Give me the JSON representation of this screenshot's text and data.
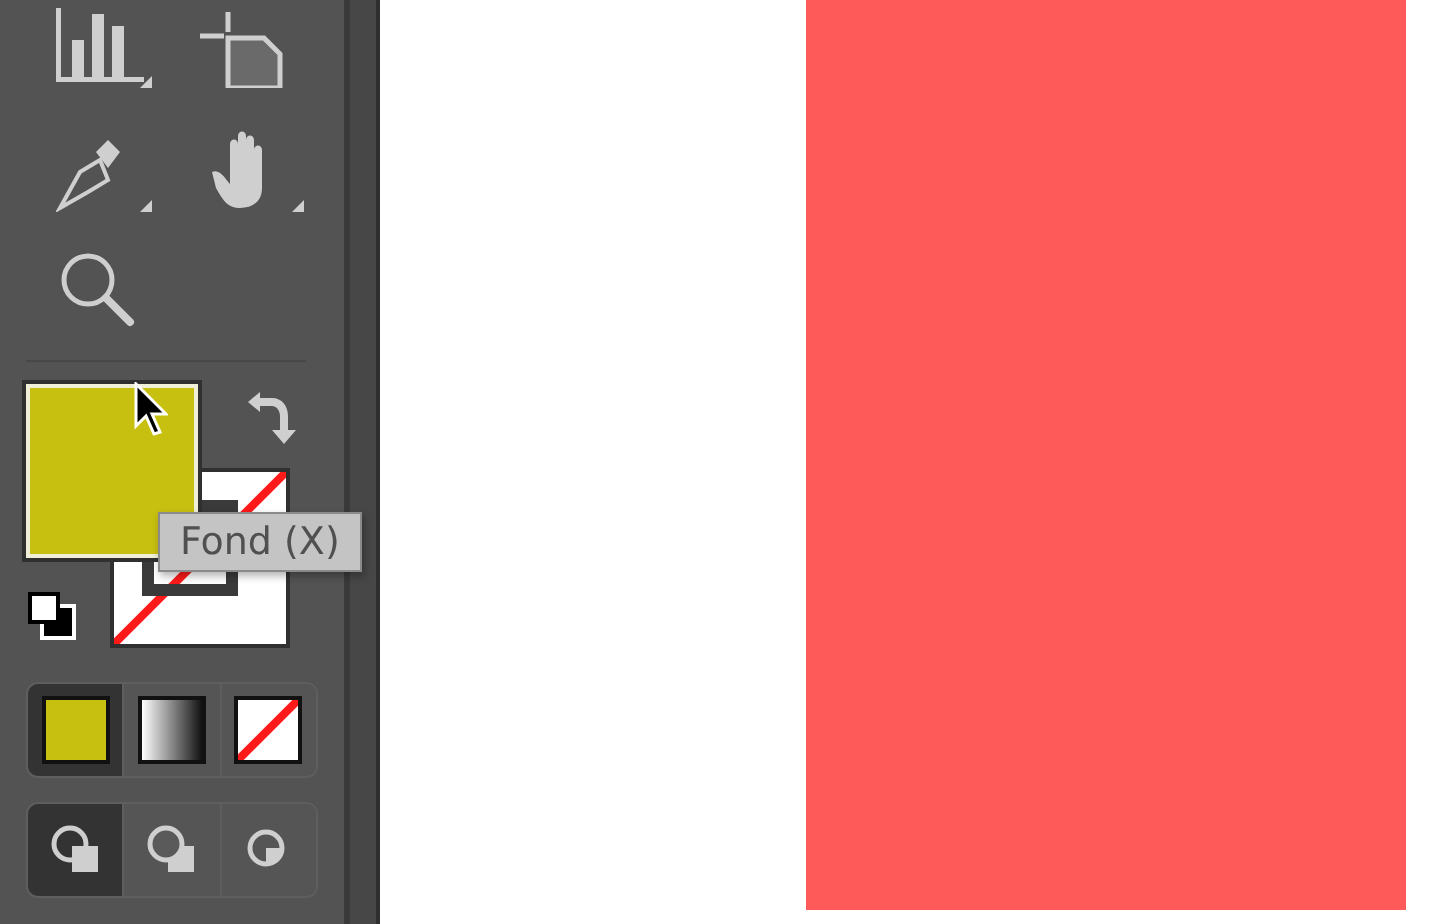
{
  "tooltip": {
    "text": "Fond (X)"
  },
  "color_modes": [
    {
      "kind": "color",
      "selected": true
    },
    {
      "kind": "gradient",
      "selected": false
    },
    {
      "kind": "none",
      "selected": false
    }
  ],
  "draw_modes": [
    {
      "kind": "normal",
      "selected": true
    },
    {
      "kind": "behind",
      "selected": false
    },
    {
      "kind": "inside",
      "selected": false
    }
  ]
}
